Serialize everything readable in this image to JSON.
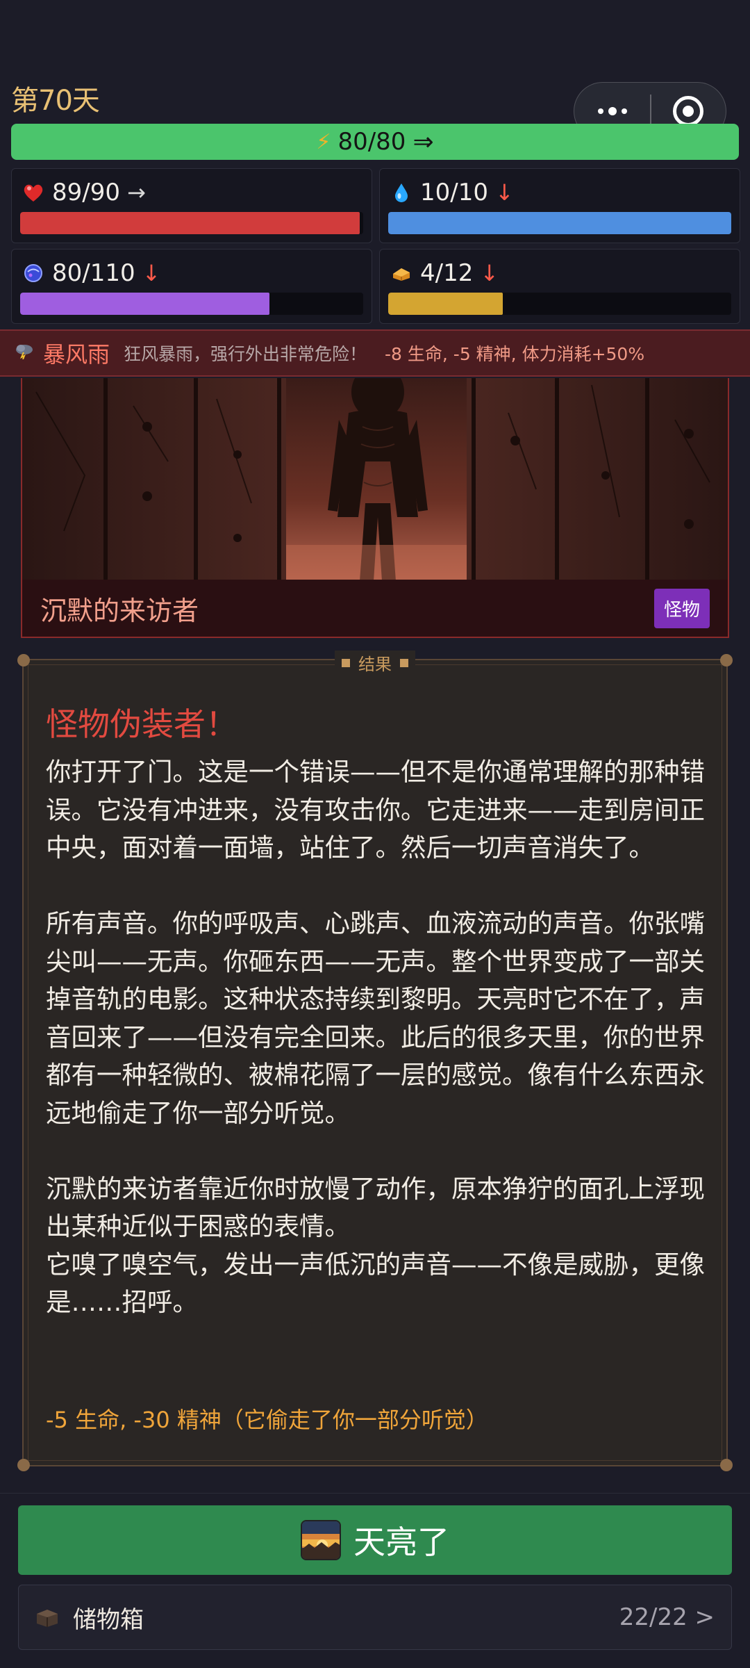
{
  "header": {
    "day_label": "第70天",
    "stamina": {
      "value": "80/80",
      "icon": "lightning-icon",
      "trend_icon": "arrow-right-icon"
    }
  },
  "stats": [
    {
      "id": "health",
      "icon": "heart-icon",
      "value": "89/90",
      "trend": "→",
      "trend_type": "flat",
      "fill_fraction": 0.989,
      "color": "#d13c3c"
    },
    {
      "id": "water",
      "icon": "water-drop-icon",
      "value": "10/10",
      "trend": "↓",
      "trend_type": "down",
      "fill_fraction": 1.0,
      "color": "#4f8fe0"
    },
    {
      "id": "spirit",
      "icon": "spirit-orb-icon",
      "value": "80/110",
      "trend": "↓",
      "trend_type": "down",
      "fill_fraction": 0.727,
      "color": "#9f5ee0"
    },
    {
      "id": "food",
      "icon": "bread-icon",
      "value": "4/12",
      "trend": "↓",
      "trend_type": "down",
      "fill_fraction": 0.333,
      "color": "#d4a531"
    }
  ],
  "weather": {
    "icon": "storm-icon",
    "name": "暴风雨",
    "description": "狂风暴雨，强行外出非常危险！",
    "effect": "-8 生命, -5 精神, 体力消耗+50%"
  },
  "event": {
    "title": "沉默的来访者",
    "tag": "怪物"
  },
  "result": {
    "legend": "结果",
    "heading": "怪物伪装者！",
    "paragraphs": [
      "你打开了门。这是一个错误——但不是你通常理解的那种错误。它没有冲进来，没有攻击你。它走进来——走到房间正中央，面对着一面墙，站住了。然后一切声音消失了。",
      "所有声音。你的呼吸声、心跳声、血液流动的声音。你张嘴尖叫——无声。你砸东西——无声。整个世界变成了一部关掉音轨的电影。这种状态持续到黎明。天亮时它不在了，声音回来了——但没有完全回来。此后的很多天里，你的世界都有一种轻微的、被棉花隔了一层的感觉。像有什么东西永远地偷走了你一部分听觉。",
      "沉默的来访者靠近你时放慢了动作，原本狰狞的面孔上浮现出某种近似于困惑的表情。",
      "它嗅了嗅空气，发出一声低沉的声音——不像是威胁，更像是……招呼。"
    ],
    "effect": "-5 生命, -30 精神（它偷走了你一部分听觉）"
  },
  "actions": {
    "continue_label": "天亮了",
    "storage_label": "储物箱",
    "storage_count": "22/22 >"
  }
}
